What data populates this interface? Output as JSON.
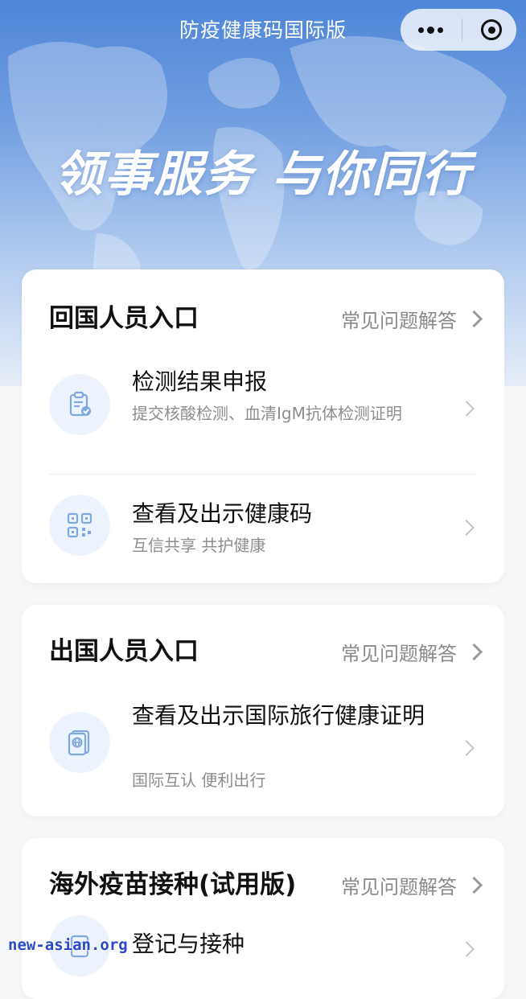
{
  "header": {
    "title": "防疫健康码国际版",
    "capsule": {
      "more_icon": "more-dots-icon",
      "close_icon": "target-circle-icon"
    }
  },
  "banner": {
    "slogan": "领事服务 与你同行"
  },
  "sections": [
    {
      "title": "回国人员入口",
      "faq_label": "常见问题解答",
      "items": [
        {
          "title": "检测结果申报",
          "subtitle": "提交核酸检测、血清IgM抗体检测证明",
          "icon": "clipboard-check-icon"
        },
        {
          "title": "查看及出示健康码",
          "subtitle": "互信共享 共护健康",
          "icon": "qr-code-icon"
        }
      ]
    },
    {
      "title": "出国人员入口",
      "faq_label": "常见问题解答",
      "items": [
        {
          "title": "查看及出示国际旅行健康证明",
          "subtitle": "国际互认 便利出行",
          "icon": "passport-icon"
        }
      ]
    },
    {
      "title": "海外疫苗接种(试用版)",
      "faq_label": "常见问题解答",
      "items": [
        {
          "title": "登记与接种",
          "icon": "document-icon"
        }
      ]
    }
  ],
  "watermark": "new-asian.org",
  "colors": {
    "hero_top": "#4f86d8",
    "icon_bg": "#edf3fc",
    "icon_stroke": "#7fa8e0",
    "watermark": "#2a49c7"
  }
}
